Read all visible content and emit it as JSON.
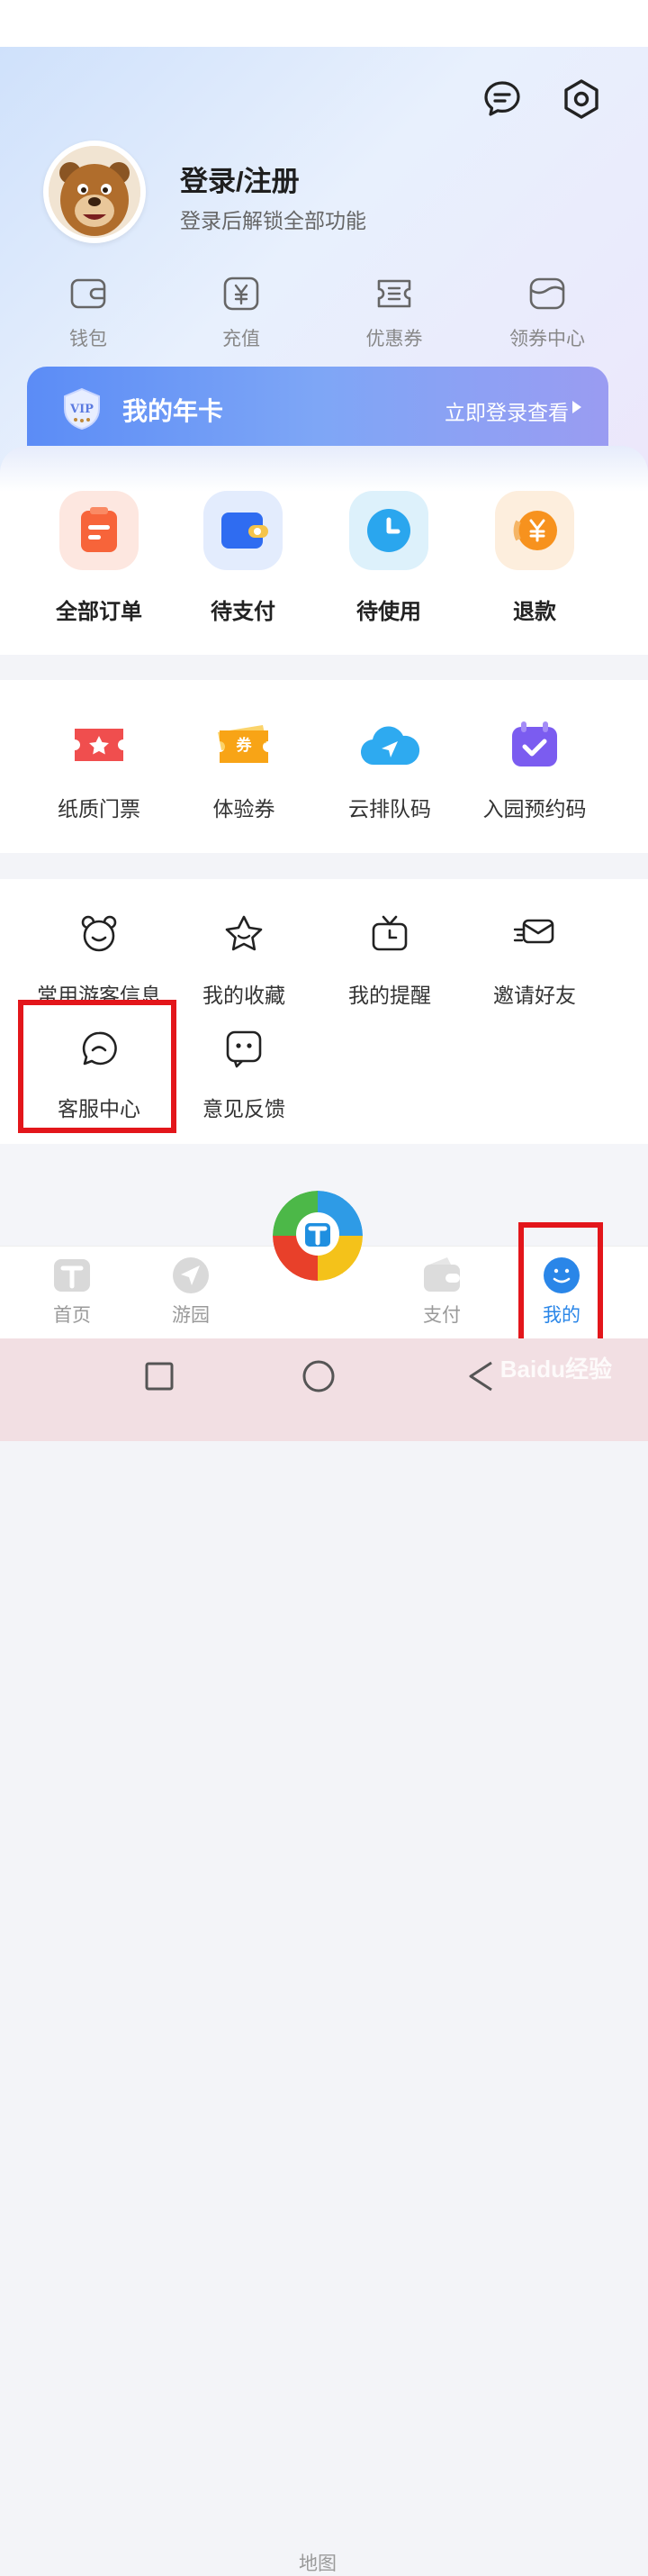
{
  "header": {
    "login_title": "登录/注册",
    "login_subtitle": "登录后解锁全部功能",
    "icons": [
      "message-icon",
      "settings-icon"
    ]
  },
  "quick_links": [
    {
      "label": "钱包",
      "icon": "wallet-icon"
    },
    {
      "label": "充值",
      "icon": "recharge-icon"
    },
    {
      "label": "优惠券",
      "icon": "coupon-icon"
    },
    {
      "label": "领券中心",
      "icon": "coupon-center-icon"
    }
  ],
  "vip_card": {
    "title": "我的年卡",
    "link_text": "立即登录查看",
    "badge_text": "VIP"
  },
  "orders": [
    {
      "label": "全部订单",
      "icon": "all-orders-icon"
    },
    {
      "label": "待支付",
      "icon": "pending-payment-icon"
    },
    {
      "label": "待使用",
      "icon": "pending-use-icon"
    },
    {
      "label": "退款",
      "icon": "refund-icon"
    }
  ],
  "tickets": [
    {
      "label": "纸质门票",
      "icon": "paper-ticket-icon"
    },
    {
      "label": "体验券",
      "icon": "experience-voucher-icon"
    },
    {
      "label": "云排队码",
      "icon": "cloud-queue-icon"
    },
    {
      "label": "入园预约码",
      "icon": "reservation-code-icon"
    }
  ],
  "services": [
    {
      "label": "常用游客信息",
      "icon": "visitor-info-icon"
    },
    {
      "label": "我的收藏",
      "icon": "favorites-icon"
    },
    {
      "label": "我的提醒",
      "icon": "reminder-icon"
    },
    {
      "label": "邀请好友",
      "icon": "invite-friends-icon"
    },
    {
      "label": "客服中心",
      "icon": "customer-service-icon"
    },
    {
      "label": "意见反馈",
      "icon": "feedback-icon"
    }
  ],
  "tabbar": {
    "tabs": [
      {
        "label": "首页",
        "icon": "home-icon"
      },
      {
        "label": "游园",
        "icon": "park-tour-icon"
      },
      {
        "label": "地图",
        "icon": "map-logo-icon"
      },
      {
        "label": "支付",
        "icon": "payment-icon"
      },
      {
        "label": "我的",
        "icon": "profile-icon"
      }
    ],
    "active": "我的"
  },
  "watermark": "Baidu经验",
  "colors": {
    "accent": "#2a86e8",
    "highlight": "#e3161b",
    "vip_start": "#5b8cf6",
    "vip_end": "#9a9cf2"
  }
}
